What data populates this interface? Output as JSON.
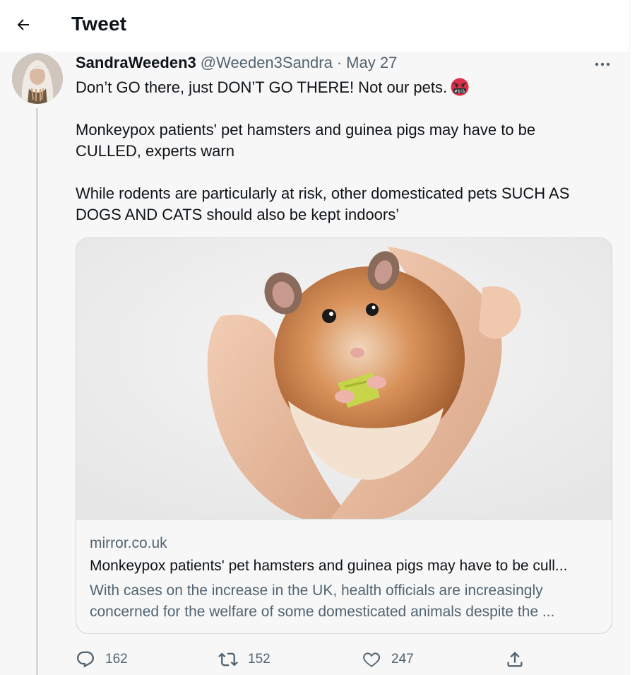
{
  "header": {
    "title": "Tweet",
    "back_icon": "arrow-left-icon"
  },
  "tweet": {
    "display_name": "SandraWeeden3",
    "handle": "@Weeden3Sandra",
    "separator": "·",
    "date": "May 27",
    "more_icon": "more-icon",
    "text": {
      "line1": "Don’t GO there, just DON’T GO THERE! Not our pets.",
      "emoji": "face-with-symbols-on-mouth",
      "paragraph2": "Monkeypox patients' pet hamsters and guinea pigs may have to be CULLED, experts warn",
      "paragraph3": "While rodents are particularly at risk, other domesticated pets SUCH AS DOGS AND CATS should also be kept indoors’"
    },
    "card": {
      "image_alt": "hamster held in cupped hands",
      "domain": "mirror.co.uk",
      "title": "Monkeypox patients' pet hamsters and guinea pigs may have to be cull...",
      "description": "With cases on the increase in the UK, health officials are increasingly concerned for the welfare of some domesticated animals despite the ..."
    },
    "actions": {
      "reply_count": "162",
      "retweet_count": "152",
      "like_count": "247",
      "reply_icon": "reply-icon",
      "retweet_icon": "retweet-icon",
      "like_icon": "heart-icon",
      "share_icon": "share-icon"
    }
  },
  "colors": {
    "text_primary": "#0f1419",
    "text_secondary": "#536471",
    "border": "#cfd9de",
    "background": "#f7f7f7"
  }
}
